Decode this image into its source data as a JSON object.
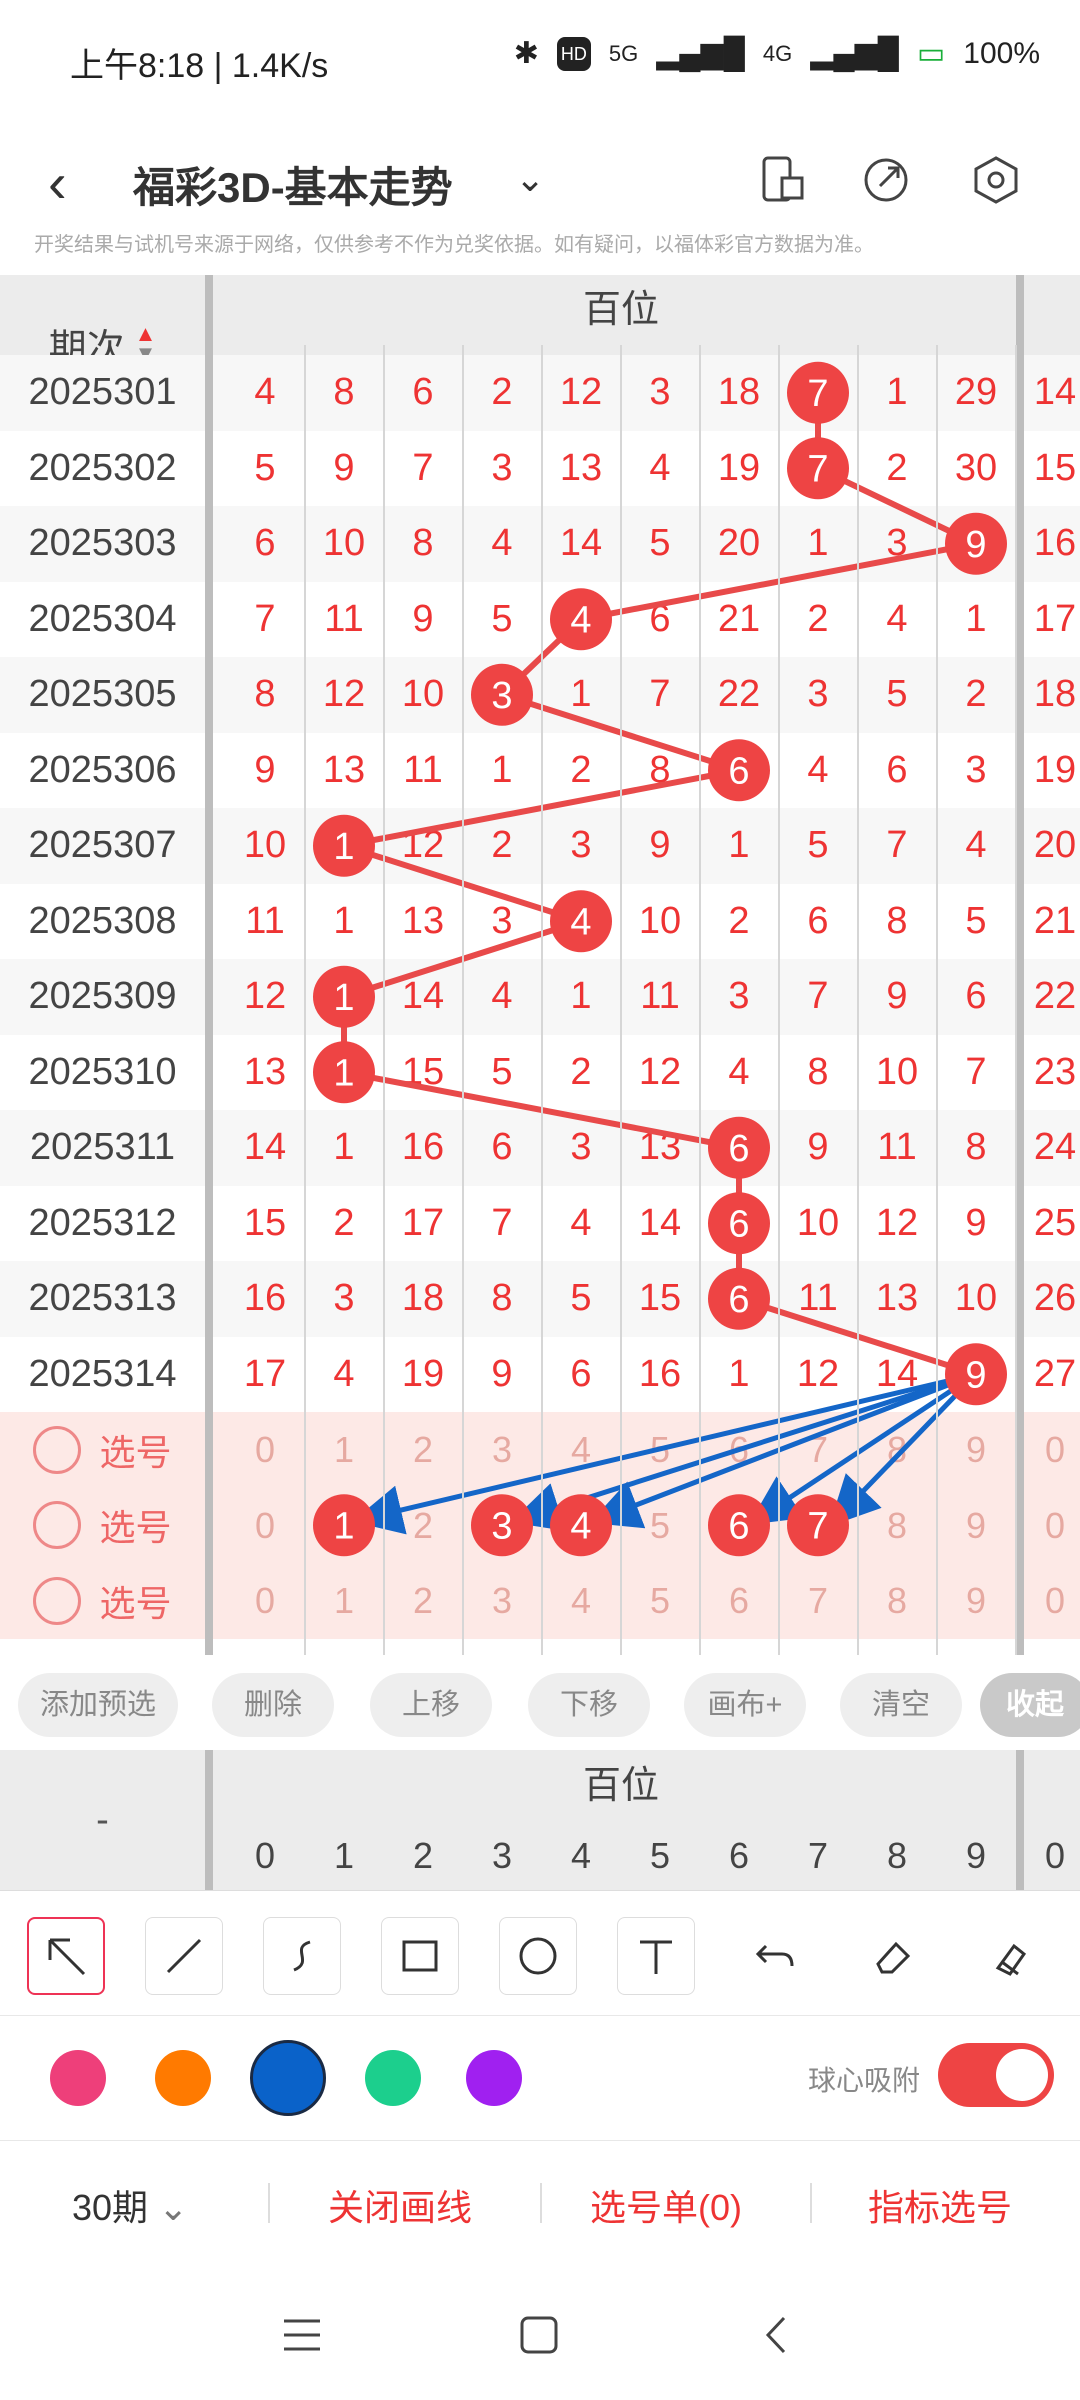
{
  "status": {
    "time": "上午8:18 | 1.4K/s",
    "battery": "100%",
    "net1": "5G",
    "net2": "4G",
    "hd": "HD"
  },
  "appbar": {
    "title": "福彩3D-基本走势",
    "notice": "开奖结果与试机号来源于网络，仅供参考不作为兑奖依据。如有疑问，以福体彩官方数据为准。"
  },
  "header": {
    "qici": "期次",
    "baiwei": "百位",
    "digits": [
      "0",
      "1",
      "2",
      "3",
      "4",
      "5",
      "6",
      "7",
      "8",
      "9",
      "0"
    ]
  },
  "rows": [
    {
      "period": "2025301",
      "cells": [
        "4",
        "8",
        "6",
        "2",
        "12",
        "3",
        "18",
        "7",
        "1",
        "29",
        "14"
      ],
      "hit": 7
    },
    {
      "period": "2025302",
      "cells": [
        "5",
        "9",
        "7",
        "3",
        "13",
        "4",
        "19",
        "7",
        "2",
        "30",
        "15"
      ],
      "hit": 7
    },
    {
      "period": "2025303",
      "cells": [
        "6",
        "10",
        "8",
        "4",
        "14",
        "5",
        "20",
        "1",
        "3",
        "9",
        "16"
      ],
      "hit": 9
    },
    {
      "period": "2025304",
      "cells": [
        "7",
        "11",
        "9",
        "5",
        "4",
        "6",
        "21",
        "2",
        "4",
        "1",
        "17"
      ],
      "hit": 4
    },
    {
      "period": "2025305",
      "cells": [
        "8",
        "12",
        "10",
        "3",
        "1",
        "7",
        "22",
        "3",
        "5",
        "2",
        "18"
      ],
      "hit": 3
    },
    {
      "period": "2025306",
      "cells": [
        "9",
        "13",
        "11",
        "1",
        "2",
        "8",
        "6",
        "4",
        "6",
        "3",
        "19"
      ],
      "hit": 6
    },
    {
      "period": "2025307",
      "cells": [
        "10",
        "1",
        "12",
        "2",
        "3",
        "9",
        "1",
        "5",
        "7",
        "4",
        "20"
      ],
      "hit": 1
    },
    {
      "period": "2025308",
      "cells": [
        "11",
        "1",
        "13",
        "3",
        "4",
        "10",
        "2",
        "6",
        "8",
        "5",
        "21"
      ],
      "hit": 4
    },
    {
      "period": "2025309",
      "cells": [
        "12",
        "1",
        "14",
        "4",
        "1",
        "11",
        "3",
        "7",
        "9",
        "6",
        "22"
      ],
      "hit": 1
    },
    {
      "period": "2025310",
      "cells": [
        "13",
        "1",
        "15",
        "5",
        "2",
        "12",
        "4",
        "8",
        "10",
        "7",
        "23"
      ],
      "hit": 1
    },
    {
      "period": "2025311",
      "cells": [
        "14",
        "1",
        "16",
        "6",
        "3",
        "13",
        "6",
        "9",
        "11",
        "8",
        "24"
      ],
      "hit": 6
    },
    {
      "period": "2025312",
      "cells": [
        "15",
        "2",
        "17",
        "7",
        "4",
        "14",
        "6",
        "10",
        "12",
        "9",
        "25"
      ],
      "hit": 6
    },
    {
      "period": "2025313",
      "cells": [
        "16",
        "3",
        "18",
        "8",
        "5",
        "15",
        "6",
        "11",
        "13",
        "10",
        "26"
      ],
      "hit": 6
    },
    {
      "period": "2025314",
      "cells": [
        "17",
        "4",
        "19",
        "9",
        "6",
        "16",
        "1",
        "12",
        "14",
        "9",
        "27"
      ],
      "hit": 9
    }
  ],
  "picks": [
    {
      "label": "选号",
      "cells": [
        "0",
        "1",
        "2",
        "3",
        "4",
        "5",
        "6",
        "7",
        "8",
        "9",
        "0"
      ],
      "selected": []
    },
    {
      "label": "选号",
      "cells": [
        "0",
        "1",
        "2",
        "3",
        "4",
        "5",
        "6",
        "7",
        "8",
        "9",
        "0"
      ],
      "selected": [
        1,
        3,
        4,
        6,
        7
      ]
    },
    {
      "label": "选号",
      "cells": [
        "0",
        "1",
        "2",
        "3",
        "4",
        "5",
        "6",
        "7",
        "8",
        "9",
        "0"
      ],
      "selected": []
    }
  ],
  "actions": [
    "添加预选",
    "删除",
    "上移",
    "下移",
    "画布+",
    "清空",
    "收起"
  ],
  "second_header": {
    "dash": "-",
    "baiwei": "百位",
    "digits": [
      "0",
      "1",
      "2",
      "3",
      "4",
      "5",
      "6",
      "7",
      "8",
      "9",
      "0"
    ]
  },
  "tools": [
    "arrow-tool",
    "line-tool",
    "curve-tool",
    "rect-tool",
    "circle-tool",
    "text-tool",
    "undo-tool",
    "eraser-tool",
    "clear-tool"
  ],
  "colors": [
    "#ee3f7a",
    "#ff7a00",
    "#0a62c9",
    "#1ccf8d",
    "#a020f0"
  ],
  "attract_label": "球心吸附",
  "bottom": {
    "periods": "30期",
    "close_draw": "关闭画线",
    "pick_list": "选号单(0)",
    "indicator_pick": "指标选号"
  },
  "accent": "#ee4444"
}
